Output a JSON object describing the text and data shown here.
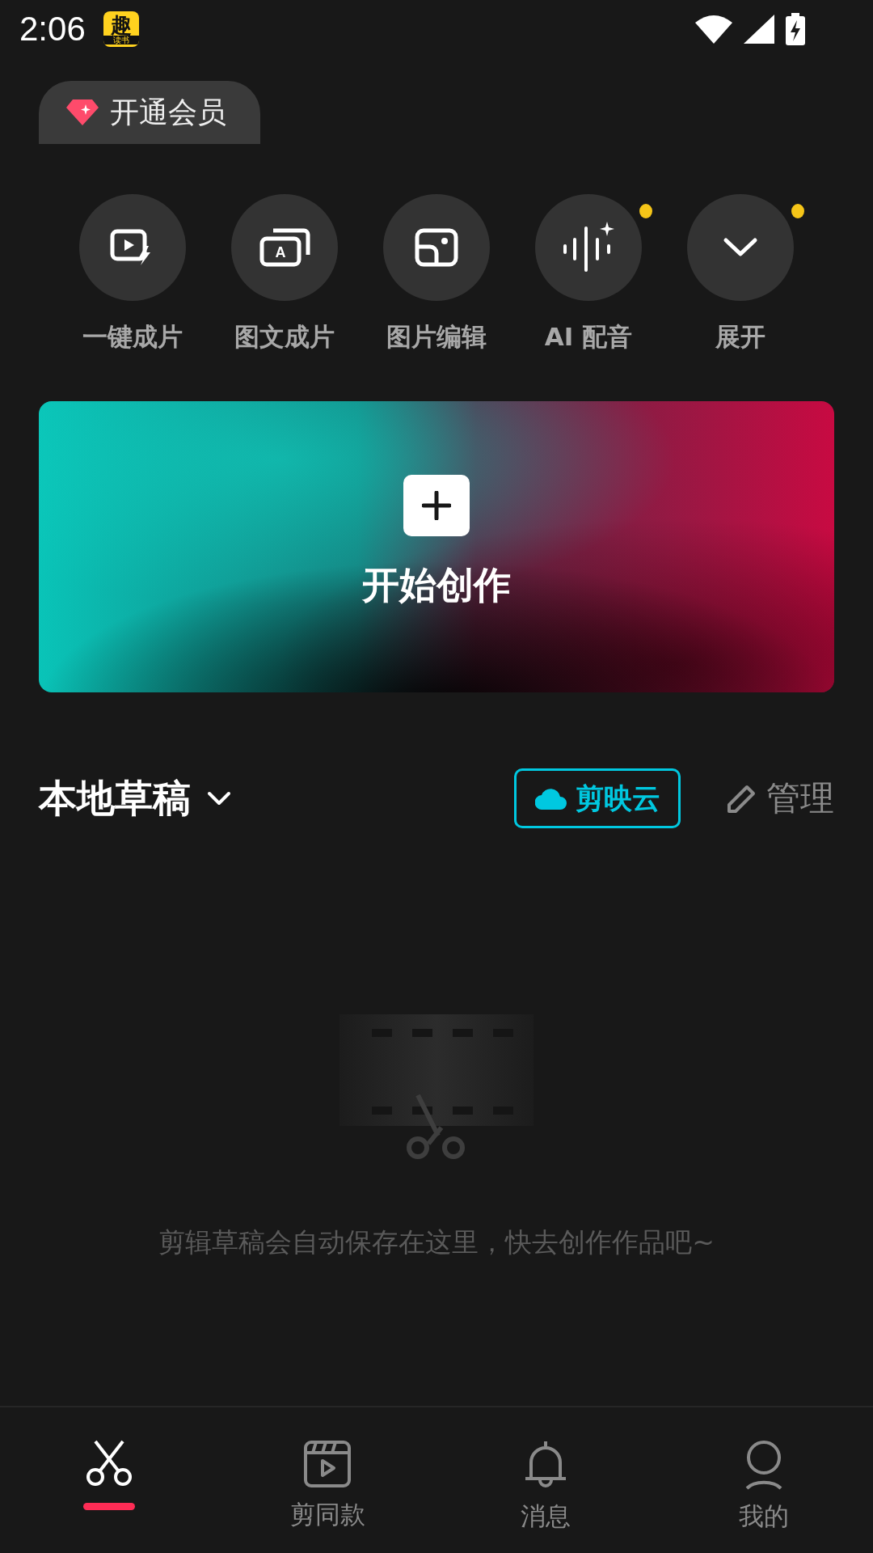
{
  "status_bar": {
    "time": "2:06",
    "app_badge": {
      "main": "趣",
      "sub": "读书"
    }
  },
  "vip_button": {
    "label": "开通会员"
  },
  "quick_actions": [
    {
      "kind": "flash-video",
      "label": "一键成片",
      "dot": false
    },
    {
      "kind": "text-image",
      "icon_text": "A",
      "label": "图文成片",
      "dot": false
    },
    {
      "kind": "photo-edit",
      "label": "图片编辑",
      "dot": false
    },
    {
      "kind": "voice",
      "label": "AI 配音",
      "dot": true
    },
    {
      "kind": "expand",
      "label": "展开",
      "dot": true
    }
  ],
  "create_banner": {
    "label": "开始创作"
  },
  "drafts_header": {
    "title": "本地草稿",
    "cloud_button": "剪映云",
    "manage": "管理"
  },
  "empty_state": {
    "message": "剪辑草稿会自动保存在这里，快去创作作品吧~"
  },
  "bottom_nav": [
    {
      "kind": "scissors",
      "selected": true
    },
    {
      "kind": "clapper",
      "label": "剪同款",
      "selected": false
    },
    {
      "kind": "bell",
      "label": "消息",
      "selected": false
    },
    {
      "kind": "person",
      "label": "我的",
      "selected": false
    }
  ]
}
